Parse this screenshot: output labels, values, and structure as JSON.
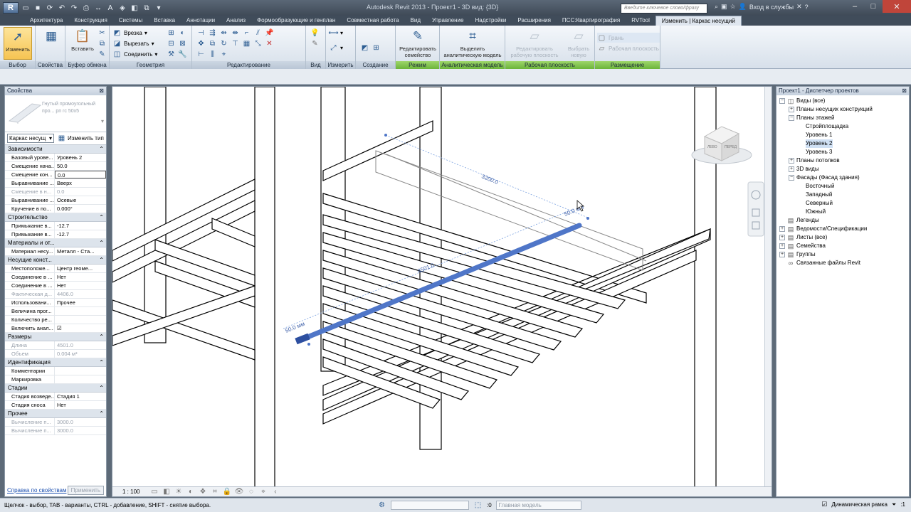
{
  "app": {
    "title": "Autodesk Revit 2013 -   Проект1 - 3D вид: {3D}",
    "logo": "R",
    "search_placeholder": "Введите ключевое слово/фразу",
    "login": "Вход в службы"
  },
  "tabs": [
    "Архитектура",
    "Конструкция",
    "Системы",
    "Вставка",
    "Аннотации",
    "Анализ",
    "Формообразующие и генплан",
    "Совместная работа",
    "Вид",
    "Управление",
    "Надстройки",
    "Расширения",
    "ПСС:Квартирография",
    "RVTool",
    "Изменить | Каркас несущий"
  ],
  "ribbon": {
    "select": {
      "modify_label": "Изменить",
      "title": "Выбор"
    },
    "properties": {
      "title": "Свойства"
    },
    "clipboard": {
      "paste_label": "Вставить",
      "title": "Буфер обмена"
    },
    "geometry": {
      "cut_label": "Врезка",
      "uncut_label": "Вырезать",
      "join_label": "Соединить",
      "title": "Геометрия"
    },
    "modify": {
      "title": "Редактирование"
    },
    "view": {
      "title": "Вид"
    },
    "measure": {
      "title": "Измерить"
    },
    "create": {
      "title": "Создание"
    },
    "mode": {
      "edit_family_label": "Редактировать семейство",
      "title": "Режим"
    },
    "analytical": {
      "highlight_label": "Выделить аналитическую модель",
      "title": "Аналитическая модель"
    },
    "workplane": {
      "edit_wp_label": "Редактировать рабочую плоскость",
      "pick_new_label": "Выбрать новую",
      "title": "Рабочая плоскость"
    },
    "placement": {
      "face_label": "Грань",
      "wp_label": "Рабочая плоскость",
      "title": "Размещение"
    }
  },
  "properties": {
    "header": "Свойства",
    "type_name": "Гнутый прямоугольный про... рп гс 50х5",
    "family_dropdown": "Каркас несущ",
    "edit_type": "Изменить тип",
    "groups": [
      {
        "name": "Зависимости",
        "rows": [
          {
            "k": "Базовый урове...",
            "v": "Уровень 2"
          },
          {
            "k": "Смещение нача...",
            "v": "50.0"
          },
          {
            "k": "Смещение кон...",
            "v": "0.0",
            "edit": true
          },
          {
            "k": "Выравнивание ...",
            "v": "Вверх"
          },
          {
            "k": "Смещение в н...",
            "v": "0.0",
            "dis": true
          },
          {
            "k": "Выравнивание ...",
            "v": "Осевые"
          },
          {
            "k": "Кручение в по...",
            "v": "0.000°"
          }
        ]
      },
      {
        "name": "Строительство",
        "rows": [
          {
            "k": "Примыкание в...",
            "v": "-12.7"
          },
          {
            "k": "Примыкание в...",
            "v": "-12.7"
          }
        ]
      },
      {
        "name": "Материалы и от...",
        "rows": [
          {
            "k": "Материал несу...",
            "v": "Металл - Ста..."
          }
        ]
      },
      {
        "name": "Несущие конст...",
        "rows": [
          {
            "k": "Местоположе...",
            "v": "Центр геоме..."
          },
          {
            "k": "Соединение в ...",
            "v": "Нет"
          },
          {
            "k": "Соединение в ...",
            "v": "Нет"
          },
          {
            "k": "Фактическая д...",
            "v": "4406.0",
            "dis": true
          },
          {
            "k": "Использовани...",
            "v": "Прочее"
          },
          {
            "k": "Величина прог...",
            "v": ""
          },
          {
            "k": "Количество ре...",
            "v": ""
          },
          {
            "k": "Включить анал...",
            "v": "☑"
          }
        ]
      },
      {
        "name": "Размеры",
        "rows": [
          {
            "k": "Длина",
            "v": "4501.0",
            "dis": true
          },
          {
            "k": "Объем",
            "v": "0.004 м³",
            "dis": true
          }
        ]
      },
      {
        "name": "Идентификация",
        "rows": [
          {
            "k": "Комментарии",
            "v": ""
          },
          {
            "k": "Маркировка",
            "v": ""
          }
        ]
      },
      {
        "name": "Стадии",
        "rows": [
          {
            "k": "Стадия возведе...",
            "v": "Стадия 1"
          },
          {
            "k": "Стадия сноса",
            "v": "Нет"
          }
        ]
      },
      {
        "name": "Прочее",
        "rows": [
          {
            "k": "Вычисление п...",
            "v": "3000.0",
            "dis": true
          },
          {
            "k": "Вычисление п...",
            "v": "3000.0",
            "dis": true
          }
        ]
      }
    ],
    "help_link": "Справка по свойствам",
    "apply": "Применить"
  },
  "view": {
    "dims": [
      "3200.0",
      "50.0 мм",
      "4501.0",
      "50.0 мм"
    ],
    "viewcube_left": "ЛЕВО",
    "viewcube_front": "ПЕРЕД",
    "scale": "1 : 100"
  },
  "browser": {
    "header": "Проект1 - Диспетчер проектов",
    "items": [
      {
        "label": "Виды (все)",
        "depth": 0,
        "exp": "−",
        "icon": "◫"
      },
      {
        "label": "Планы несущих конструкций",
        "depth": 1,
        "exp": "+"
      },
      {
        "label": "Планы этажей",
        "depth": 1,
        "exp": "−"
      },
      {
        "label": "Стройплощадка",
        "depth": 2
      },
      {
        "label": "Уровень 1",
        "depth": 2
      },
      {
        "label": "Уровень 2",
        "depth": 2,
        "sel": true
      },
      {
        "label": "Уровень 3",
        "depth": 2
      },
      {
        "label": "Планы потолков",
        "depth": 1,
        "exp": "+"
      },
      {
        "label": "3D виды",
        "depth": 1,
        "exp": "+"
      },
      {
        "label": "Фасады (Фасад здания)",
        "depth": 1,
        "exp": "−"
      },
      {
        "label": "Восточный",
        "depth": 2
      },
      {
        "label": "Западный",
        "depth": 2
      },
      {
        "label": "Северный",
        "depth": 2
      },
      {
        "label": "Южный",
        "depth": 2
      },
      {
        "label": "Легенды",
        "depth": 0,
        "icon": "▤"
      },
      {
        "label": "Ведомости/Спецификации",
        "depth": 0,
        "exp": "+",
        "icon": "▤"
      },
      {
        "label": "Листы (все)",
        "depth": 0,
        "exp": "+",
        "icon": "▤"
      },
      {
        "label": "Семейства",
        "depth": 0,
        "exp": "+",
        "icon": "▤"
      },
      {
        "label": "Группы",
        "depth": 0,
        "exp": "+",
        "icon": "▤"
      },
      {
        "label": "Связанные файлы Revit",
        "depth": 0,
        "icon": "∞"
      }
    ]
  },
  "status": {
    "text": "Щелчок - выбор, TAB - варианты, CTRL - добавление, SHIFT - снятие выбора.",
    "count": ":0",
    "model_combo": "Главная модель",
    "dynamic_frame": "Динамическая рамка",
    "filter_count": ":1"
  },
  "colors": {
    "selection": "#4f76c8",
    "context_tab": "#6ec23f"
  }
}
